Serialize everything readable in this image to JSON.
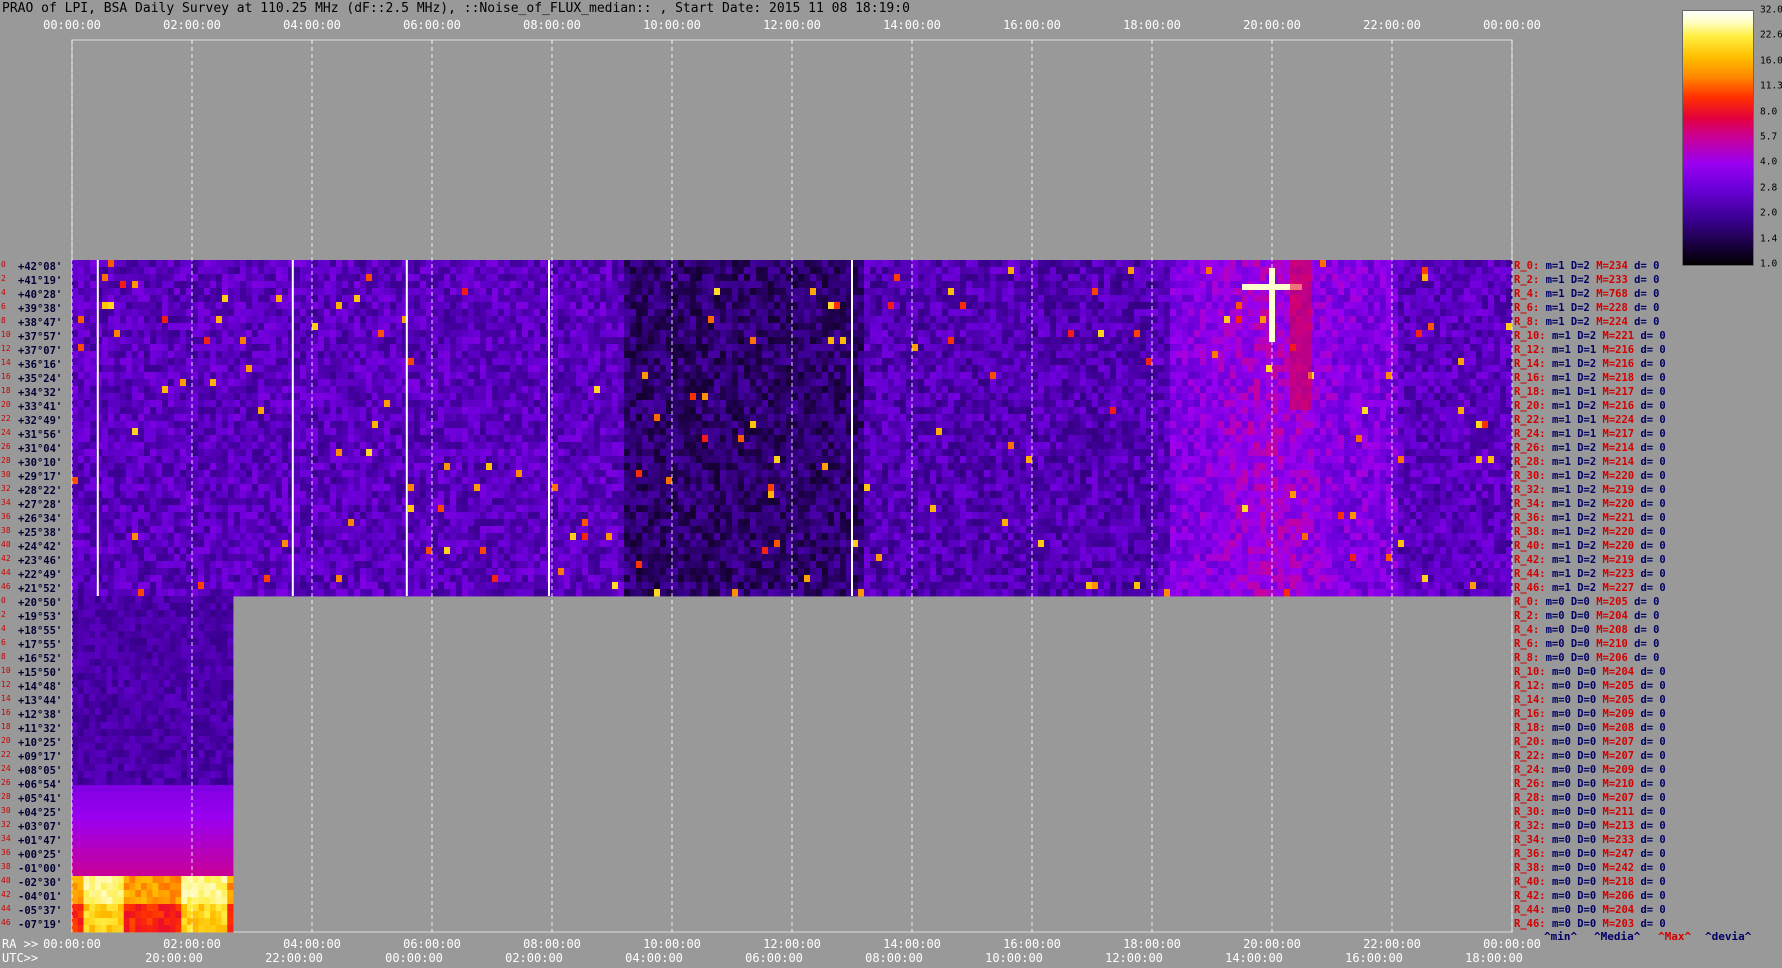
{
  "title": "PRAO of LPI, BSA Daily Survey at 110.25 MHz (dF::2.5 MHz), ::Noise_of_FLUX_median:: , Start Date: 2015 11 08 18:19:0",
  "chart_data": {
    "type": "heatmap",
    "top_axis_ticks": [
      "00:00:00",
      "02:00:00",
      "04:00:00",
      "06:00:00",
      "08:00:00",
      "10:00:00",
      "12:00:00",
      "14:00:00",
      "16:00:00",
      "18:00:00",
      "20:00:00",
      "22:00:00",
      "00:00:00"
    ],
    "ra_label": "RA >>",
    "ra_ticks": [
      "00:00:00",
      "02:00:00",
      "04:00:00",
      "06:00:00",
      "08:00:00",
      "10:00:00",
      "12:00:00",
      "14:00:00",
      "16:00:00",
      "18:00:00",
      "20:00:00",
      "22:00:00",
      "00:00:00"
    ],
    "utc_label": "UTC>>",
    "utc_ticks": [
      "20:00:00",
      "22:00:00",
      "00:00:00",
      "02:00:00",
      "04:00:00",
      "06:00:00",
      "08:00:00",
      "10:00:00",
      "12:00:00",
      "14:00:00",
      "16:00:00",
      "18:00:00"
    ],
    "declinations_upper": [
      "+42°08'",
      "+41°19'",
      "+40°28'",
      "+39°38'",
      "+38°47'",
      "+37°57'",
      "+37°07'",
      "+36°16'",
      "+35°24'",
      "+34°32'",
      "+33°41'",
      "+32°49'",
      "+31°56'",
      "+31°04'",
      "+30°10'",
      "+29°17'",
      "+28°22'",
      "+27°28'",
      "+26°34'",
      "+25°38'",
      "+24°42'",
      "+23°46'",
      "+22°49'",
      "+21°52'"
    ],
    "declinations_lower": [
      "+20°50'",
      "+19°53'",
      "+18°55'",
      "+17°55'",
      "+16°52'",
      "+15°50'",
      "+14°48'",
      "+13°44'",
      "+12°38'",
      "+11°32'",
      "+10°25'",
      "+09°17'",
      "+08°05'",
      "+06°54'",
      "+05°41'",
      "+04°25'",
      "+03°07'",
      "+01°47'",
      "+00°25'",
      "-01°00'",
      "-02°30'",
      "-04°01'",
      "-05°37'",
      "-07°19'"
    ],
    "colorbar": [
      "32.0",
      "22.6",
      "16.0",
      "11.3",
      "8.0",
      "5.7",
      "4.0",
      "2.8",
      "2.0",
      "1.4",
      "1.0"
    ],
    "rows_upper": [
      [
        "R_0:",
        "1",
        "2",
        "234",
        "0"
      ],
      [
        "R_2:",
        "1",
        "2",
        "233",
        "0"
      ],
      [
        "R_4:",
        "1",
        "2",
        "768",
        "0"
      ],
      [
        "R_6:",
        "1",
        "2",
        "228",
        "0"
      ],
      [
        "R_8:",
        "1",
        "2",
        "224",
        "0"
      ],
      [
        "R_10:",
        "1",
        "2",
        "221",
        "0"
      ],
      [
        "R_12:",
        "1",
        "1",
        "216",
        "0"
      ],
      [
        "R_14:",
        "1",
        "2",
        "216",
        "0"
      ],
      [
        "R_16:",
        "1",
        "2",
        "218",
        "0"
      ],
      [
        "R_18:",
        "1",
        "1",
        "217",
        "0"
      ],
      [
        "R_20:",
        "1",
        "2",
        "216",
        "0"
      ],
      [
        "R_22:",
        "1",
        "1",
        "224",
        "0"
      ],
      [
        "R_24:",
        "1",
        "1",
        "217",
        "0"
      ],
      [
        "R_26:",
        "1",
        "2",
        "214",
        "0"
      ],
      [
        "R_28:",
        "1",
        "2",
        "214",
        "0"
      ],
      [
        "R_30:",
        "1",
        "2",
        "220",
        "0"
      ],
      [
        "R_32:",
        "1",
        "2",
        "219",
        "0"
      ],
      [
        "R_34:",
        "1",
        "2",
        "220",
        "0"
      ],
      [
        "R_36:",
        "1",
        "2",
        "221",
        "0"
      ],
      [
        "R_38:",
        "1",
        "2",
        "220",
        "0"
      ],
      [
        "R_40:",
        "1",
        "2",
        "220",
        "0"
      ],
      [
        "R_42:",
        "1",
        "2",
        "219",
        "0"
      ],
      [
        "R_44:",
        "1",
        "2",
        "223",
        "0"
      ],
      [
        "R_46:",
        "1",
        "2",
        "227",
        "0"
      ]
    ],
    "rows_lower": [
      [
        "R_0:",
        "0",
        "0",
        "205",
        "0"
      ],
      [
        "R_2:",
        "0",
        "0",
        "204",
        "0"
      ],
      [
        "R_4:",
        "0",
        "0",
        "208",
        "0"
      ],
      [
        "R_6:",
        "0",
        "0",
        "210",
        "0"
      ],
      [
        "R_8:",
        "0",
        "0",
        "206",
        "0"
      ],
      [
        "R_10:",
        "0",
        "0",
        "204",
        "0"
      ],
      [
        "R_12:",
        "0",
        "0",
        "205",
        "0"
      ],
      [
        "R_14:",
        "0",
        "0",
        "205",
        "0"
      ],
      [
        "R_16:",
        "0",
        "0",
        "209",
        "0"
      ],
      [
        "R_18:",
        "0",
        "0",
        "208",
        "0"
      ],
      [
        "R_20:",
        "0",
        "0",
        "207",
        "0"
      ],
      [
        "R_22:",
        "0",
        "0",
        "207",
        "0"
      ],
      [
        "R_24:",
        "0",
        "0",
        "209",
        "0"
      ],
      [
        "R_26:",
        "0",
        "0",
        "210",
        "0"
      ],
      [
        "R_28:",
        "0",
        "0",
        "207",
        "0"
      ],
      [
        "R_30:",
        "0",
        "0",
        "211",
        "0"
      ],
      [
        "R_32:",
        "0",
        "0",
        "213",
        "0"
      ],
      [
        "R_34:",
        "0",
        "0",
        "233",
        "0"
      ],
      [
        "R_36:",
        "0",
        "0",
        "247",
        "0"
      ],
      [
        "R_38:",
        "0",
        "0",
        "242",
        "0"
      ],
      [
        "R_40:",
        "0",
        "0",
        "218",
        "0"
      ],
      [
        "R_42:",
        "0",
        "0",
        "206",
        "0"
      ],
      [
        "R_44:",
        "0",
        "0",
        "204",
        "0"
      ],
      [
        "R_46:",
        "0",
        "0",
        "203",
        "0"
      ]
    ],
    "bottom_legend": [
      "^min^",
      "^Media^",
      "^Max^",
      "^devia^"
    ]
  },
  "colors": {
    "background": "#999999",
    "text_red": "#d40000",
    "text_blue": "#000066"
  }
}
